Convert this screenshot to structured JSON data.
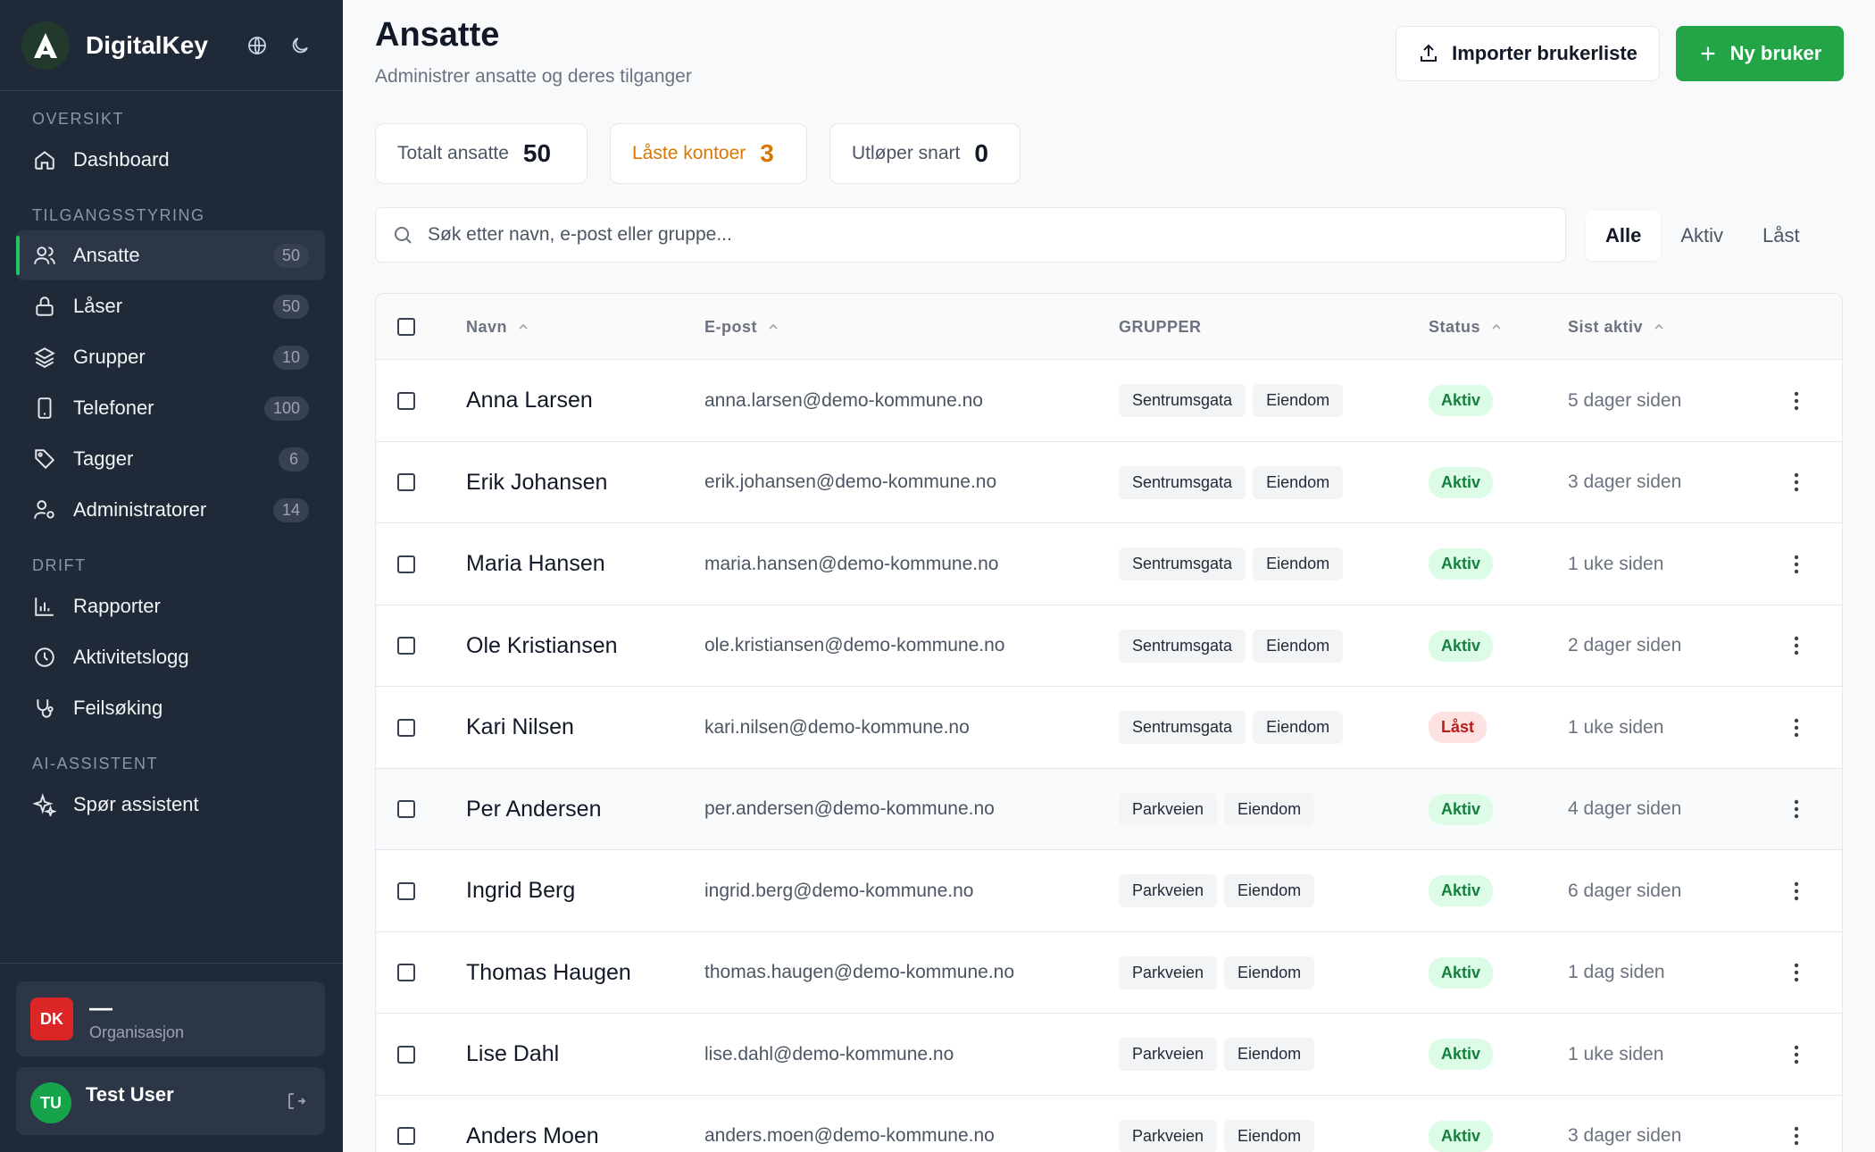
{
  "app": {
    "name": "DigitalKey",
    "icons": [
      "globe-icon",
      "moon-icon"
    ]
  },
  "nav": {
    "sections": {
      "overview": "OVERSIKT",
      "access": "TILGANGSSTYRING",
      "ops": "DRIFT",
      "ai": "AI-ASSISTENT"
    },
    "dashboard": "Dashboard",
    "employees": {
      "label": "Ansatte",
      "count": "50"
    },
    "locks": {
      "label": "Låser",
      "count": "50"
    },
    "groups": {
      "label": "Grupper",
      "count": "10"
    },
    "phones": {
      "label": "Telefoner",
      "count": "100"
    },
    "tags": {
      "label": "Tagger",
      "count": "6"
    },
    "admins": {
      "label": "Administratorer",
      "count": "14"
    },
    "reports": "Rapporter",
    "activity": "Aktivitetslogg",
    "troubleshoot": "Feilsøking",
    "assistant": "Spør assistent"
  },
  "org": {
    "badge": "DK",
    "name": "—",
    "sub": "Organisasjon"
  },
  "user": {
    "initials": "TU",
    "name": "Test User"
  },
  "header": {
    "title": "Ansatte",
    "subtitle": "Administrer ansatte og deres tilganger",
    "import_label": "Importer brukerliste",
    "new_label": "Ny bruker"
  },
  "stats": {
    "total": {
      "label": "Totalt ansatte",
      "value": "50"
    },
    "locked": {
      "label": "Låste kontoer",
      "value": "3"
    },
    "expiring": {
      "label": "Utløper snart",
      "value": "0"
    }
  },
  "search": {
    "placeholder": "Søk etter navn, e-post eller gruppe..."
  },
  "filters": [
    "Alle",
    "Aktiv",
    "Låst"
  ],
  "table": {
    "headers": {
      "name": "Navn",
      "email": "E-post",
      "groups": "GRUPPER",
      "status": "Status",
      "last": "Sist aktiv"
    },
    "rows": [
      {
        "name": "Anna Larsen",
        "email": "anna.larsen@demo-kommune.no",
        "groups": [
          "Sentrumsgata",
          "Eiendom"
        ],
        "status": "Aktiv",
        "last": "5 dager siden"
      },
      {
        "name": "Erik Johansen",
        "email": "erik.johansen@demo-kommune.no",
        "groups": [
          "Sentrumsgata",
          "Eiendom"
        ],
        "status": "Aktiv",
        "last": "3 dager siden"
      },
      {
        "name": "Maria Hansen",
        "email": "maria.hansen@demo-kommune.no",
        "groups": [
          "Sentrumsgata",
          "Eiendom"
        ],
        "status": "Aktiv",
        "last": "1 uke siden"
      },
      {
        "name": "Ole Kristiansen",
        "email": "ole.kristiansen@demo-kommune.no",
        "groups": [
          "Sentrumsgata",
          "Eiendom"
        ],
        "status": "Aktiv",
        "last": "2 dager siden"
      },
      {
        "name": "Kari Nilsen",
        "email": "kari.nilsen@demo-kommune.no",
        "groups": [
          "Sentrumsgata",
          "Eiendom"
        ],
        "status": "Låst",
        "last": "1 uke siden"
      },
      {
        "name": "Per Andersen",
        "email": "per.andersen@demo-kommune.no",
        "groups": [
          "Parkveien",
          "Eiendom"
        ],
        "status": "Aktiv",
        "last": "4 dager siden"
      },
      {
        "name": "Ingrid Berg",
        "email": "ingrid.berg@demo-kommune.no",
        "groups": [
          "Parkveien",
          "Eiendom"
        ],
        "status": "Aktiv",
        "last": "6 dager siden"
      },
      {
        "name": "Thomas Haugen",
        "email": "thomas.haugen@demo-kommune.no",
        "groups": [
          "Parkveien",
          "Eiendom"
        ],
        "status": "Aktiv",
        "last": "1 dag siden"
      },
      {
        "name": "Lise Dahl",
        "email": "lise.dahl@demo-kommune.no",
        "groups": [
          "Parkveien",
          "Eiendom"
        ],
        "status": "Aktiv",
        "last": "1 uke siden"
      },
      {
        "name": "Anders Moen",
        "email": "anders.moen@demo-kommune.no",
        "groups": [
          "Parkveien",
          "Eiendom"
        ],
        "status": "Aktiv",
        "last": "3 dager siden"
      }
    ]
  },
  "colors": {
    "accent": "#22a447",
    "sidebar": "#1f2937",
    "warning": "#d97706",
    "danger": "#dc2626"
  }
}
